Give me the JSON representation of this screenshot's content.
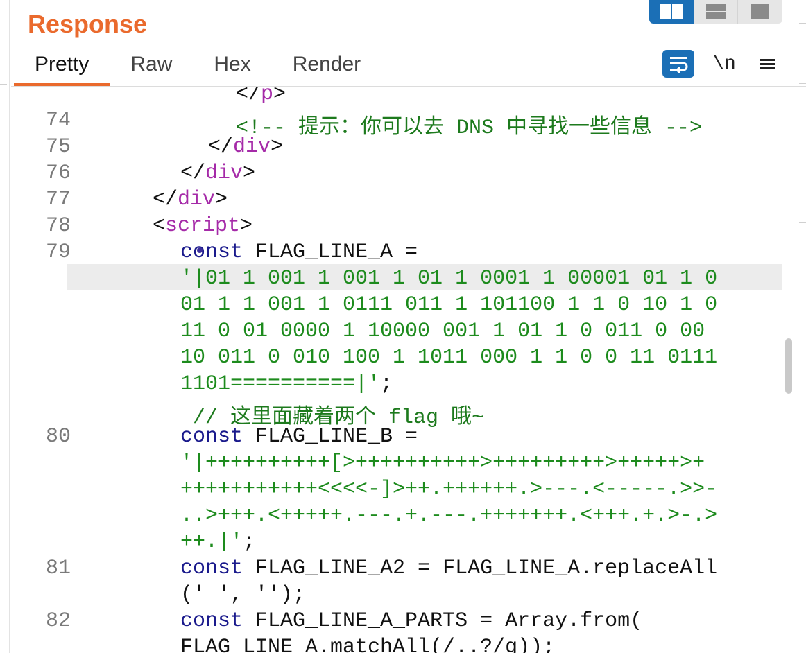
{
  "header": {
    "title": "Response"
  },
  "view_modes": [
    {
      "name": "split-view",
      "active": true
    },
    {
      "name": "horizontal-view",
      "active": false
    },
    {
      "name": "single-view",
      "active": false
    }
  ],
  "tabs": [
    {
      "label": "Pretty",
      "active": true
    },
    {
      "label": "Raw",
      "active": false
    },
    {
      "label": "Hex",
      "active": false
    },
    {
      "label": "Render",
      "active": false
    }
  ],
  "tools": {
    "newline_label": "\\n"
  },
  "colors": {
    "accent": "#ea6a2d",
    "active_blue": "#1b6fb6",
    "tag": "#a52aa8",
    "keyword": "#1a1a8c",
    "string": "#1d8b1d"
  },
  "code": {
    "lines": [
      {
        "num": "",
        "parts": [
          {
            "t": "</",
            "c": "plain"
          },
          {
            "t": "p",
            "c": "tag"
          },
          {
            "t": ">",
            "c": "plain"
          }
        ],
        "indent": 12
      },
      {
        "num": "74",
        "parts": [
          {
            "t": "<!-- 提示：你可以去 DNS 中寻找一些信息 -->",
            "c": "cmt"
          }
        ],
        "indent": 12
      },
      {
        "num": "75",
        "parts": [
          {
            "t": "</",
            "c": "plain"
          },
          {
            "t": "div",
            "c": "tag"
          },
          {
            "t": ">",
            "c": "plain"
          }
        ],
        "indent": 10
      },
      {
        "num": "76",
        "parts": [
          {
            "t": "</",
            "c": "plain"
          },
          {
            "t": "div",
            "c": "tag"
          },
          {
            "t": ">",
            "c": "plain"
          }
        ],
        "indent": 8
      },
      {
        "num": "77",
        "parts": [
          {
            "t": "</",
            "c": "plain"
          },
          {
            "t": "div",
            "c": "tag"
          },
          {
            "t": ">",
            "c": "plain"
          }
        ],
        "indent": 6
      },
      {
        "num": "78",
        "parts": [
          {
            "t": "<",
            "c": "plain"
          },
          {
            "t": "script",
            "c": "tag"
          },
          {
            "t": ">",
            "c": "plain"
          }
        ],
        "indent": 6
      },
      {
        "num": "79",
        "parts": [
          {
            "t": "const",
            "c": "kw"
          },
          {
            "t": " FLAG_LINE_A =",
            "c": "plain"
          }
        ],
        "indent": 8
      },
      {
        "num": "",
        "parts": [
          {
            "t": "'|01 1 001 1 001 1 01 1 0001 1 00001 01 1 0",
            "c": "str"
          }
        ],
        "indent": 8
      },
      {
        "num": "",
        "parts": [
          {
            "t": "01 1 1 001 1 0111 011 1 101100 1 1 0 10 1 0",
            "c": "str"
          }
        ],
        "indent": 8
      },
      {
        "num": "",
        "parts": [
          {
            "t": "11 0 01 0000 1 10000 001 1 01 1 0 011 0 00",
            "c": "str"
          }
        ],
        "indent": 8
      },
      {
        "num": "",
        "parts": [
          {
            "t": "10 011 0 010 100 1 1011 000 1 1 0 0 11 0111",
            "c": "str"
          }
        ],
        "indent": 8
      },
      {
        "num": "",
        "parts": [
          {
            "t": "1101==========|'",
            "c": "str"
          },
          {
            "t": ";",
            "c": "plain"
          }
        ],
        "indent": 8
      },
      {
        "num": "",
        "parts": [
          {
            "t": " // 这里面藏着两个 flag 哦~",
            "c": "cmt"
          }
        ],
        "indent": 8
      },
      {
        "num": "80",
        "parts": [
          {
            "t": "const",
            "c": "kw"
          },
          {
            "t": " FLAG_LINE_B =",
            "c": "plain"
          }
        ],
        "indent": 8
      },
      {
        "num": "",
        "parts": [
          {
            "t": "'|++++++++++[>++++++++++>+++++++++>+++++>+",
            "c": "str"
          }
        ],
        "indent": 8
      },
      {
        "num": "",
        "parts": [
          {
            "t": "+++++++++++<<<<-]>++.++++++.>---.<-----.>>-",
            "c": "str"
          }
        ],
        "indent": 8
      },
      {
        "num": "",
        "parts": [
          {
            "t": "..>+++.<+++++.---.+.---.+++++++.<+++.+.>-.>",
            "c": "str"
          }
        ],
        "indent": 8
      },
      {
        "num": "",
        "parts": [
          {
            "t": "++.|'",
            "c": "str"
          },
          {
            "t": ";",
            "c": "plain"
          }
        ],
        "indent": 8
      },
      {
        "num": "81",
        "parts": [
          {
            "t": "const",
            "c": "kw"
          },
          {
            "t": " FLAG_LINE_A2 = FLAG_LINE_A.replaceAll",
            "c": "plain"
          }
        ],
        "indent": 8
      },
      {
        "num": "",
        "parts": [
          {
            "t": "(' ', '');",
            "c": "plain"
          }
        ],
        "indent": 8
      },
      {
        "num": "82",
        "parts": [
          {
            "t": "const",
            "c": "kw"
          },
          {
            "t": " FLAG_LINE_A_PARTS = Array.from(",
            "c": "plain"
          }
        ],
        "indent": 8
      },
      {
        "num": "",
        "parts": [
          {
            "t": "FLAG_LINE_A.matchAll(/..?/g));",
            "c": "plain"
          }
        ],
        "indent": 8
      }
    ]
  }
}
